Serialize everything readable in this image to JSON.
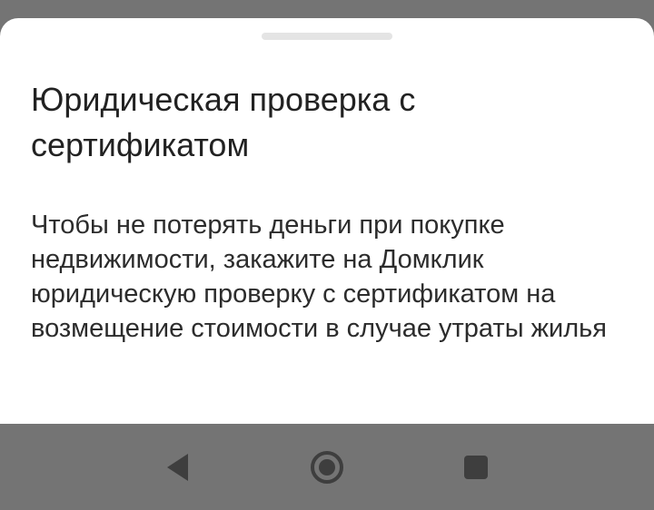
{
  "sheet": {
    "title": "Юридическая проверка с сертификатом",
    "body": "Чтобы не потерять деньги при покупке недвижимости, закажите на Домклик юридическую проверку с сертификатом на возмещение стоимости в случае утраты жилья"
  },
  "nav_bar": {
    "buttons": [
      {
        "name": "back",
        "icon": "triangle-back-icon"
      },
      {
        "name": "home",
        "icon": "circle-home-icon"
      },
      {
        "name": "recents",
        "icon": "square-recents-icon"
      }
    ]
  },
  "colors": {
    "scrim": "#747474",
    "sheet": "#ffffff",
    "handle": "#e4e4e4",
    "title_text": "#222222",
    "body_text": "#2c2c2c",
    "nav_icon": "#3e3e3e"
  }
}
